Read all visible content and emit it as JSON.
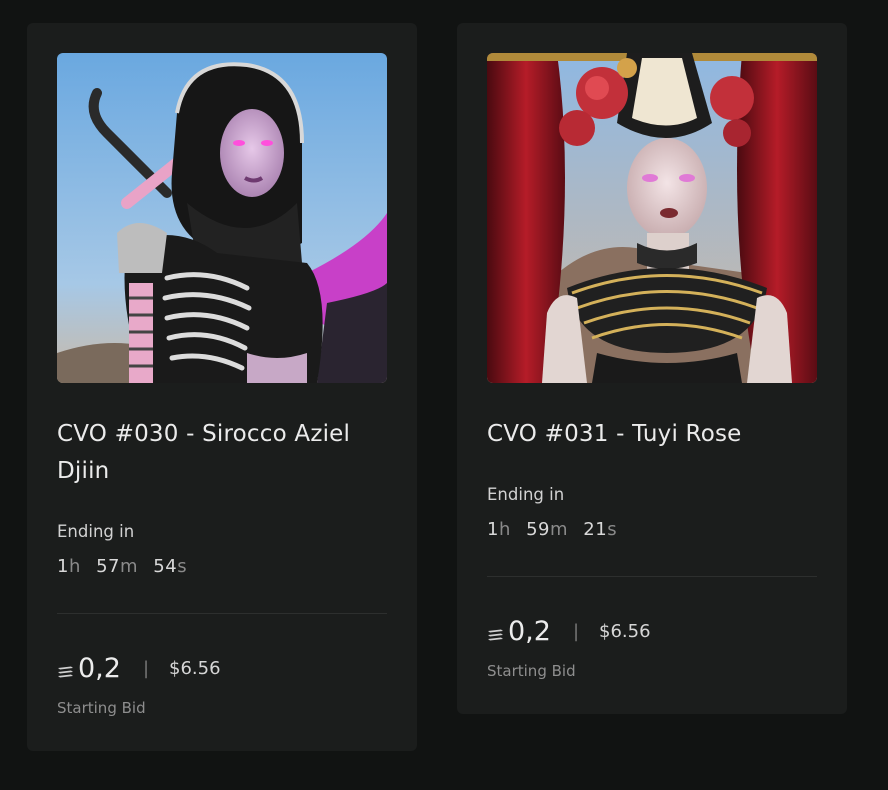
{
  "cards": [
    {
      "title": "CVO #030 - Sirocco Aziel Djiin",
      "ending_label": "Ending in",
      "countdown": {
        "h": "1",
        "h_unit": "h",
        "m": "57",
        "m_unit": "m",
        "s": "54",
        "s_unit": "s"
      },
      "price_eth": "0,2",
      "separator": "|",
      "price_usd": "$6.56",
      "bid_label": "Starting Bid",
      "image_icon": "nft-artwork-hooded-figure"
    },
    {
      "title": "CVO #031 - Tuyi Rose",
      "ending_label": "Ending in",
      "countdown": {
        "h": "1",
        "h_unit": "h",
        "m": "59",
        "m_unit": "m",
        "s": "21",
        "s_unit": "s"
      },
      "price_eth": "0,2",
      "separator": "|",
      "price_usd": "$6.56",
      "bid_label": "Starting Bid",
      "image_icon": "nft-artwork-rose-headdress"
    }
  ],
  "colors": {
    "background": "#111312",
    "card": "#1b1d1c",
    "text": "#ebebeb",
    "muted": "#8e8e8e"
  }
}
